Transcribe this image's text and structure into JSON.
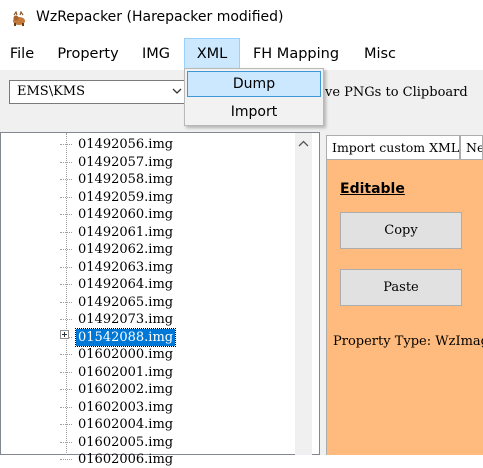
{
  "window": {
    "title": "WzRepacker (Harepacker modified)",
    "icon": "deer-icon"
  },
  "menubar": {
    "items": [
      "File",
      "Property",
      "IMG",
      "XML",
      "FH Mapping",
      "Misc"
    ],
    "open_menu": "XML"
  },
  "xml_menu": {
    "items": [
      "Dump",
      "Import"
    ],
    "highlighted": "Dump"
  },
  "toolbar": {
    "combo_value": "EMS\\KMS",
    "clipped_label": "ve PNGs to Clipboard"
  },
  "tree": {
    "items": [
      "01492056.img",
      "01492057.img",
      "01492058.img",
      "01492059.img",
      "01492060.img",
      "01492061.img",
      "01492062.img",
      "01492063.img",
      "01492064.img",
      "01492065.img",
      "01492073.img",
      "01542088.img",
      "01602000.img",
      "01602001.img",
      "01602002.img",
      "01602003.img",
      "01602004.img",
      "01602005.img",
      "01602006.img"
    ],
    "selected": "01542088.img"
  },
  "right_panel": {
    "tabs": [
      "Import custom XML",
      "Ne"
    ],
    "editable_label": "Editable",
    "copy_label": "Copy",
    "paste_label": "Paste",
    "property_type": "Property Type: WzImage"
  },
  "colors": {
    "selection": "#0078d7",
    "menu_highlight": "#cce8ff",
    "panel_orange": "#ffbb7d"
  }
}
